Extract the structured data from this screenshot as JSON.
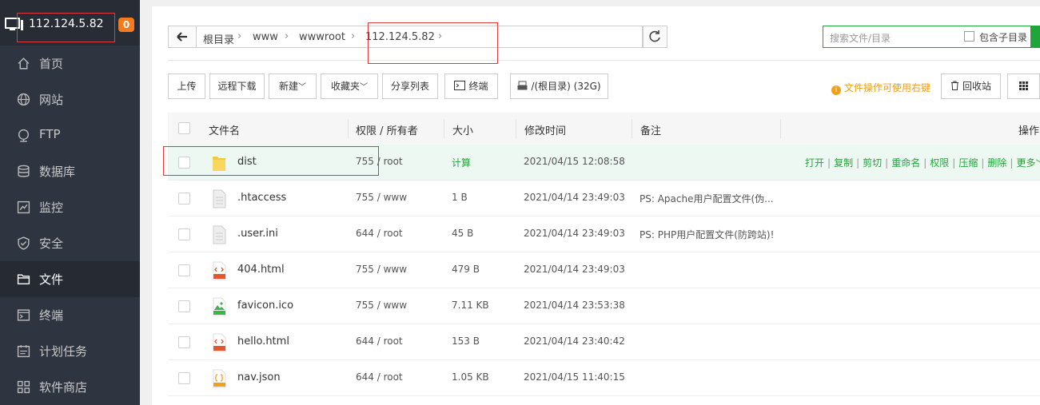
{
  "server": {
    "ip": "112.124.5.82",
    "badge": "0"
  },
  "nav": [
    {
      "label": "首页",
      "icon": "home-icon"
    },
    {
      "label": "网站",
      "icon": "globe-icon"
    },
    {
      "label": "FTP",
      "icon": "ftp-icon"
    },
    {
      "label": "数据库",
      "icon": "database-icon"
    },
    {
      "label": "监控",
      "icon": "monitor-chart-icon"
    },
    {
      "label": "安全",
      "icon": "shield-icon"
    },
    {
      "label": "文件",
      "icon": "folder-icon"
    },
    {
      "label": "终端",
      "icon": "terminal-icon"
    },
    {
      "label": "计划任务",
      "icon": "calendar-icon"
    },
    {
      "label": "软件商店",
      "icon": "apps-icon"
    }
  ],
  "breadcrumb": [
    "根目录",
    "www",
    "wwwroot",
    "112.124.5.82"
  ],
  "search": {
    "placeholder": "搜索文件/目录",
    "include_sub": "包含子目录"
  },
  "toolbar": {
    "upload": "上传",
    "remote_download": "远程下载",
    "new": "新建",
    "favorites": "收藏夹",
    "share_list": "分享列表",
    "terminal": "终端",
    "disk": "/(根目录) (32G)",
    "tip": "文件操作可使用右键",
    "recycle": "回收站"
  },
  "columns": {
    "name": "文件名",
    "perm": "权限 / 所有者",
    "size": "大小",
    "mtime": "修改时间",
    "note": "备注",
    "ops": "操作"
  },
  "files": [
    {
      "name": "dist",
      "type": "folder",
      "perm": "755 / root",
      "size": "计算",
      "mtime": "2021/04/15 12:08:58",
      "note": ""
    },
    {
      "name": ".htaccess",
      "type": "file",
      "perm": "755 / www",
      "size": "1 B",
      "mtime": "2021/04/14 23:49:03",
      "note": "PS: Apache用户配置文件(伪..."
    },
    {
      "name": ".user.ini",
      "type": "file",
      "perm": "644 / root",
      "size": "45 B",
      "mtime": "2021/04/14 23:49:03",
      "note": "PS: PHP用户配置文件(防跨站)!"
    },
    {
      "name": "404.html",
      "type": "html",
      "perm": "755 / www",
      "size": "479 B",
      "mtime": "2021/04/14 23:49:03",
      "note": ""
    },
    {
      "name": "favicon.ico",
      "type": "ico",
      "perm": "755 / www",
      "size": "7.11 KB",
      "mtime": "2021/04/14 23:53:38",
      "note": ""
    },
    {
      "name": "hello.html",
      "type": "html",
      "perm": "644 / root",
      "size": "153 B",
      "mtime": "2021/04/14 23:40:42",
      "note": ""
    },
    {
      "name": "nav.json",
      "type": "json",
      "perm": "644 / root",
      "size": "1.05 KB",
      "mtime": "2021/04/15 11:40:15",
      "note": ""
    }
  ],
  "row_ops": [
    "打开",
    "复制",
    "剪切",
    "重命名",
    "权限",
    "压缩",
    "删除",
    "更多"
  ]
}
